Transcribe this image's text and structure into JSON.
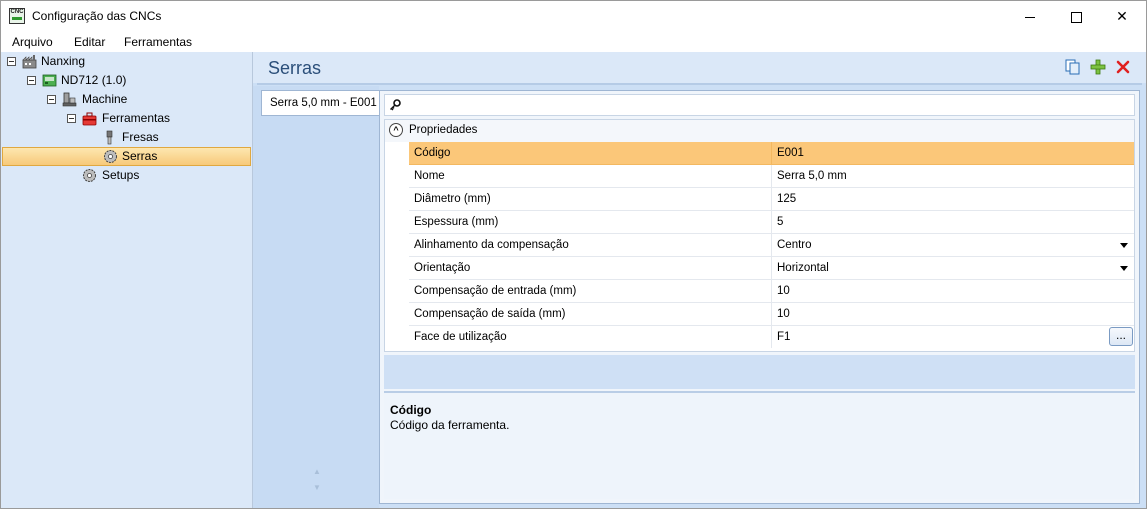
{
  "window": {
    "title": "Configuração das CNCs",
    "app_icon_text": "CNC"
  },
  "menu": [
    "Arquivo",
    "Editar",
    "Ferramentas"
  ],
  "tree": {
    "root": "Nanxing",
    "machine_model": "ND712 (1.0)",
    "machine": "Machine",
    "tools": "Ferramentas",
    "drills": "Fresas",
    "saws": "Serras",
    "setups": "Setups"
  },
  "header": {
    "title": "Serras"
  },
  "tab": {
    "label": "Serra 5,0 mm - E001"
  },
  "search": {
    "value": ""
  },
  "properties": {
    "category": "Propriedades",
    "rows": [
      {
        "name": "Código",
        "value": "E001"
      },
      {
        "name": "Nome",
        "value": "Serra 5,0 mm"
      },
      {
        "name": "Diâmetro (mm)",
        "value": "125"
      },
      {
        "name": "Espessura (mm)",
        "value": "5"
      },
      {
        "name": "Alinhamento da compensação",
        "value": "Centro"
      },
      {
        "name": "Orientação",
        "value": "Horizontal"
      },
      {
        "name": "Compensação de entrada (mm)",
        "value": "10"
      },
      {
        "name": "Compensação de saída (mm)",
        "value": "10"
      },
      {
        "name": "Face de utilização",
        "value": "F1"
      }
    ],
    "ellipsis_label": "..."
  },
  "description": {
    "title": "Código",
    "text": "Código da ferramenta."
  },
  "colors": {
    "accent_selected": "#fbc779",
    "panel": "#dbe8f8",
    "header_text": "#2b4f7a"
  }
}
